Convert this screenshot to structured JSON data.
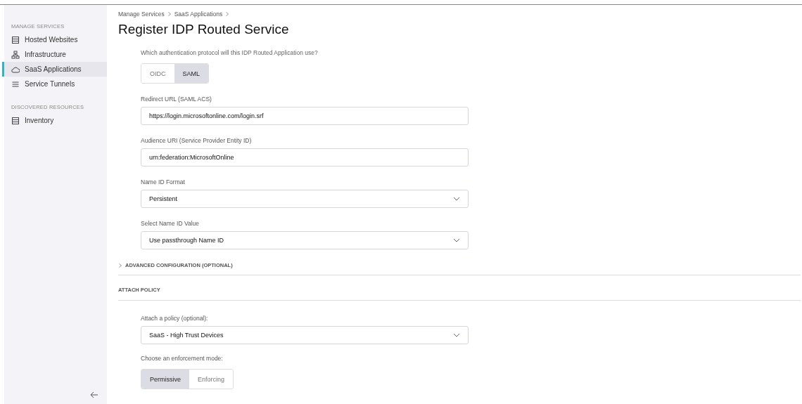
{
  "sidebar": {
    "sections": [
      {
        "heading": "MANAGE SERVICES",
        "items": [
          {
            "label": "Hosted Websites",
            "kind": "list",
            "selected": false
          },
          {
            "label": "Infrastructure",
            "kind": "nodes",
            "selected": false
          },
          {
            "label": "SaaS Applications",
            "kind": "cloud",
            "selected": true
          },
          {
            "label": "Service Tunnels",
            "kind": "lines",
            "selected": false
          }
        ]
      },
      {
        "heading": "DISCOVERED RESOURCES",
        "items": [
          {
            "label": "Inventory",
            "kind": "list",
            "selected": false
          }
        ]
      }
    ]
  },
  "breadcrumb": [
    "Manage Services",
    "SaaS Applications"
  ],
  "title": "Register IDP Routed Service",
  "protocol": {
    "question": "Which authentication protocol will this IDP Routed Application use?",
    "options": [
      {
        "label": "OIDC",
        "selected": false
      },
      {
        "label": "SAML",
        "selected": true
      }
    ]
  },
  "fields": [
    {
      "kind": "text",
      "label": "Redirect URL (SAML ACS)",
      "value": "https://login.microsoftonline.com/login.srf"
    },
    {
      "kind": "text",
      "label": "Audience URI (Service Provider Entity ID)",
      "value": "urn:federation:MicrosoftOnline"
    },
    {
      "kind": "select",
      "label": "Name ID Format",
      "value": "Persistent"
    },
    {
      "kind": "select",
      "label": "Select Name ID Value",
      "value": "Use passthrough Name ID"
    }
  ],
  "advanced": {
    "label": "ADVANCED CONFIGURATION (OPTIONAL)",
    "expanded": false
  },
  "attach_policy": {
    "heading": "ATTACH POLICY",
    "policy_label": "Attach a policy (optional):",
    "policy_value": "SaaS - High Trust Devices",
    "mode_label": "Choose an enforcement mode:",
    "modes": [
      {
        "label": "Permissive",
        "selected": true
      },
      {
        "label": "Enforcing",
        "selected": false
      }
    ]
  }
}
